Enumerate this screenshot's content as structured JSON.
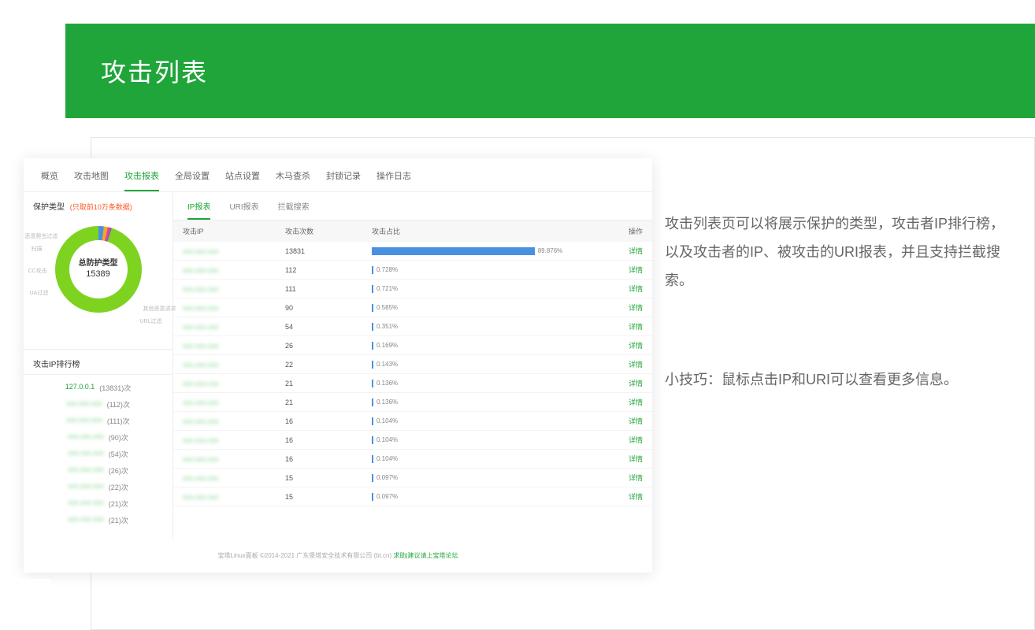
{
  "header": {
    "title": "攻击列表"
  },
  "description": {
    "p1": "攻击列表页可以将展示保护的类型，攻击者IP排行榜，以及攻击者的IP、被攻击的URI报表，并且支持拦截搜索。",
    "p2": "小技巧：鼠标点击IP和URI可以查看更多信息。"
  },
  "top_tabs": [
    "概览",
    "攻击地图",
    "攻击报表",
    "全局设置",
    "站点设置",
    "木马查杀",
    "封锁记录",
    "操作日志"
  ],
  "top_active": 2,
  "chart": {
    "title": "保护类型",
    "note": "(只取前10万条数据)",
    "center_label": "总防护类型",
    "center_value": "15389",
    "legends": [
      "恶意爬虫过滤",
      "扫描",
      "CC攻击",
      "UA过滤",
      "其他恶意请求",
      "URL过滤"
    ]
  },
  "rank": {
    "title": "攻击IP排行榜",
    "items": [
      {
        "ip": "127.0.0.1",
        "count": "(13831)次",
        "top": true
      },
      {
        "ip": "xxx.xxx.xxx",
        "count": "(112)次"
      },
      {
        "ip": "xxx.xxx.xxx",
        "count": "(111)次"
      },
      {
        "ip": "xxx.xxx.xxx",
        "count": "(90)次"
      },
      {
        "ip": "xxx.xxx.xxx",
        "count": "(54)次"
      },
      {
        "ip": "xxx.xxx.xxx",
        "count": "(26)次"
      },
      {
        "ip": "xxx.xxx.xxx",
        "count": "(22)次"
      },
      {
        "ip": "xxx.xxx.xxx",
        "count": "(21)次"
      },
      {
        "ip": "xxx.xxx.xxx",
        "count": "(21)次"
      }
    ]
  },
  "sub_tabs": [
    "IP报表",
    "URI报表",
    "拦截搜索"
  ],
  "sub_active": 0,
  "table": {
    "headers": [
      "攻击IP",
      "攻击次数",
      "攻击占比",
      "操作"
    ],
    "detail_label": "详情",
    "rows": [
      {
        "count": "13831",
        "pct": "89.876%",
        "bar": 89.876
      },
      {
        "count": "112",
        "pct": "0.728%",
        "bar": 0.728
      },
      {
        "count": "111",
        "pct": "0.721%",
        "bar": 0.721
      },
      {
        "count": "90",
        "pct": "0.585%",
        "bar": 0.585
      },
      {
        "count": "54",
        "pct": "0.351%",
        "bar": 0.351
      },
      {
        "count": "26",
        "pct": "0.169%",
        "bar": 0.169
      },
      {
        "count": "22",
        "pct": "0.143%",
        "bar": 0.143
      },
      {
        "count": "21",
        "pct": "0.136%",
        "bar": 0.136
      },
      {
        "count": "21",
        "pct": "0.136%",
        "bar": 0.136
      },
      {
        "count": "16",
        "pct": "0.104%",
        "bar": 0.104
      },
      {
        "count": "16",
        "pct": "0.104%",
        "bar": 0.104
      },
      {
        "count": "16",
        "pct": "0.104%",
        "bar": 0.104
      },
      {
        "count": "15",
        "pct": "0.097%",
        "bar": 0.097
      },
      {
        "count": "15",
        "pct": "0.097%",
        "bar": 0.097
      }
    ]
  },
  "footer": {
    "text": "宝塔Linux面板 ©2014-2021 广东堡塔安全技术有限公司 (bt.cn) ",
    "link": "求助|建议请上宝塔论坛"
  },
  "chart_data": {
    "type": "pie",
    "title": "总防护类型",
    "total": 15389,
    "slices_approx": [
      {
        "name": "其他恶意请求",
        "pct": 95
      },
      {
        "name": "恶意爬虫过滤",
        "pct": 2
      },
      {
        "name": "扫描",
        "pct": 1.5
      },
      {
        "name": "CC攻击",
        "pct": 0.7
      },
      {
        "name": "UA过滤",
        "pct": 0.8
      }
    ]
  }
}
